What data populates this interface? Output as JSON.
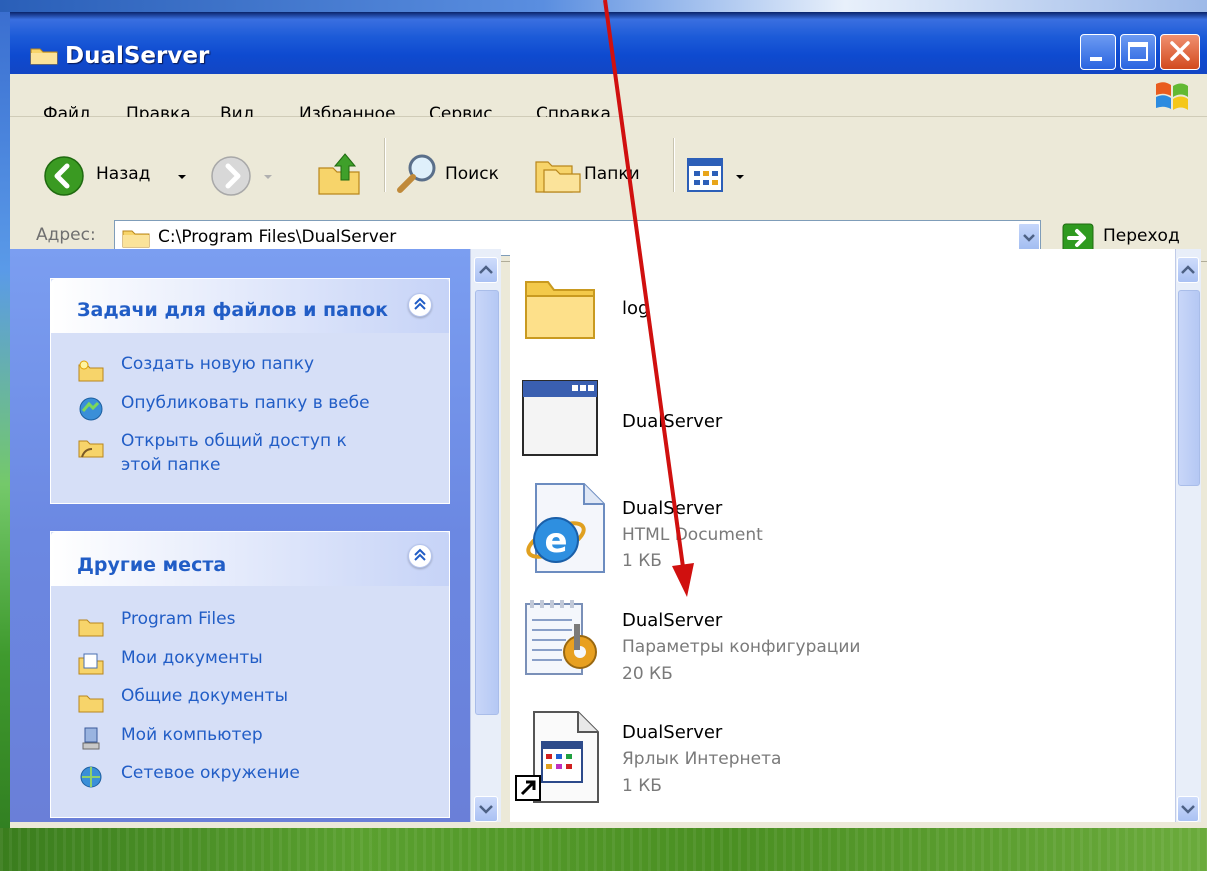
{
  "window": {
    "title": "DualServer"
  },
  "menu": {
    "items": [
      "Файл",
      "Правка",
      "Вид",
      "Избранное",
      "Сервис",
      "Справка"
    ]
  },
  "toolbar": {
    "back_label": "Назад",
    "search_label": "Поиск",
    "folders_label": "Папки"
  },
  "address": {
    "label": "Адрес:",
    "path": "C:\\Program Files\\DualServer",
    "go_label": "Переход"
  },
  "tasks_panel": {
    "title": "Задачи для файлов и папок",
    "items": [
      {
        "label": "Создать новую папку",
        "icon": "new-folder-icon"
      },
      {
        "label": "Опубликовать папку в вебе",
        "icon": "publish-web-icon"
      },
      {
        "label": "Открыть общий доступ к",
        "label2": "этой папке",
        "icon": "share-folder-icon"
      }
    ]
  },
  "places_panel": {
    "title": "Другие места",
    "items": [
      {
        "label": "Program Files",
        "icon": "folder-icon"
      },
      {
        "label": "Мои документы",
        "icon": "my-documents-icon"
      },
      {
        "label": "Общие документы",
        "icon": "folder-icon"
      },
      {
        "label": "Мой компьютер",
        "icon": "my-computer-icon"
      },
      {
        "label": "Сетевое окружение",
        "icon": "network-icon"
      }
    ]
  },
  "files": [
    {
      "name": "log",
      "type": "",
      "size": "",
      "icon": "folder-icon"
    },
    {
      "name": "DualServer",
      "type": "",
      "size": "",
      "icon": "application-icon"
    },
    {
      "name": "DualServer",
      "type": "HTML Document",
      "size": "1 КБ",
      "icon": "html-document-icon"
    },
    {
      "name": "DualServer",
      "type": "Параметры конфигурации",
      "size": "20 КБ",
      "icon": "config-file-icon"
    },
    {
      "name": "DualServer",
      "type": "Ярлык Интернета",
      "size": "1 КБ",
      "icon": "internet-shortcut-icon"
    }
  ],
  "colors": {
    "title_bar": "#0e4ad0",
    "task_pane": "#6b88e2",
    "link": "#215dc6",
    "annotation_arrow": "#d0100f"
  }
}
